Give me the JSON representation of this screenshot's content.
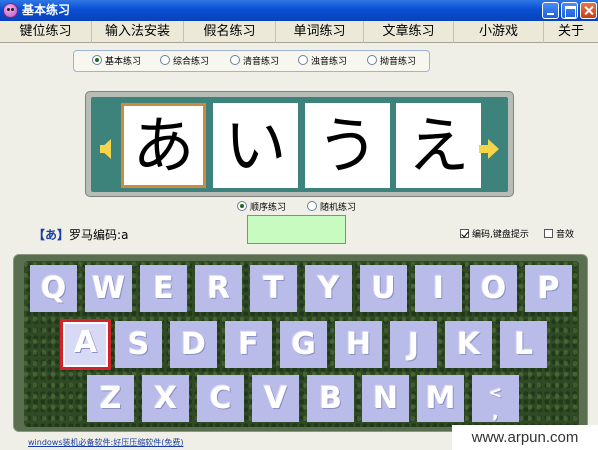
{
  "window": {
    "title": "基本练习"
  },
  "tabs": [
    "键位练习",
    "输入法安装",
    "假名练习",
    "单词练习",
    "文章练习",
    "小游戏",
    "关于"
  ],
  "mode_options": [
    {
      "label": "基本练习",
      "selected": true
    },
    {
      "label": "综合练习",
      "selected": false
    },
    {
      "label": "清音练习",
      "selected": false
    },
    {
      "label": "浊音练习",
      "selected": false
    },
    {
      "label": "拗音练习",
      "selected": false
    }
  ],
  "kana_display": {
    "cards": [
      "あ",
      "い",
      "う",
      "え"
    ],
    "selected_index": 0,
    "arrow_color": "#f6d54a",
    "panel_color": "#3e827c",
    "highlight_color": "#d08a3c"
  },
  "order_options": [
    {
      "label": "顺序练习",
      "selected": true
    },
    {
      "label": "随机练习",
      "selected": false
    }
  ],
  "romaji": {
    "kana": "【あ】",
    "label": "罗马编码:",
    "code": "a"
  },
  "answer_input": {
    "value": "",
    "color": "#c8fbc0"
  },
  "settings": [
    {
      "label": "编码,键盘提示",
      "checked": true
    },
    {
      "label": "音效",
      "checked": false
    }
  ],
  "keyboard": {
    "rows": [
      [
        "Q",
        "W",
        "E",
        "R",
        "T",
        "Y",
        "U",
        "I",
        "O",
        "P"
      ],
      [
        "A",
        "S",
        "D",
        "F",
        "G",
        "H",
        "J",
        "K",
        "L"
      ],
      [
        "Z",
        "X",
        "C",
        "V",
        "B",
        "N",
        "M",
        "<\n,"
      ]
    ],
    "active_key": "A",
    "key_color": "#b9bbe8",
    "active_border_color": "#d0242a"
  },
  "footer": {
    "link_text": "windows装机必备软件:好压压缩软件(免费)"
  },
  "watermark": "www.arpun.com"
}
